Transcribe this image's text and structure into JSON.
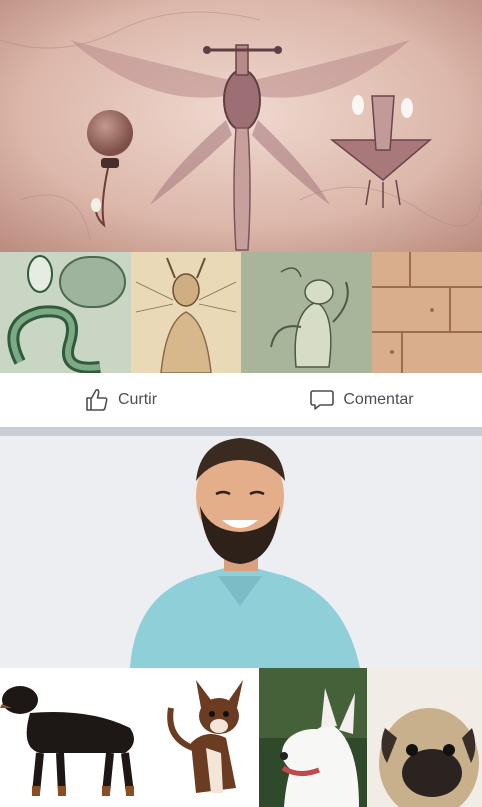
{
  "feed": {
    "post1": {
      "hero": {
        "icon": "cave-drawing-creatures-image"
      },
      "thumbnails": [
        {
          "icon": "serpent-creature-sketch"
        },
        {
          "icon": "antennae-humanoid-sketch"
        },
        {
          "icon": "frog-creature-sketch"
        },
        {
          "icon": "stone-tile-texture"
        }
      ],
      "actions": {
        "like_label": "Curtir",
        "comment_label": "Comentar",
        "like_icon": "thumbs-up-icon",
        "comment_icon": "speech-bubble-icon"
      }
    },
    "post2": {
      "hero": {
        "icon": "smiling-bearded-man-photo"
      },
      "thumbnails": [
        {
          "icon": "dachshund-photo"
        },
        {
          "icon": "chihuahua-photo"
        },
        {
          "icon": "bull-terrier-photo"
        },
        {
          "icon": "pug-photo"
        }
      ]
    }
  },
  "colors": {
    "divider": "#c9ced6",
    "action_text": "#4b4f56",
    "cave_wall": "#d8b0a3",
    "shirt": "#8ecfd8",
    "photo_bg": "#eceef1"
  }
}
